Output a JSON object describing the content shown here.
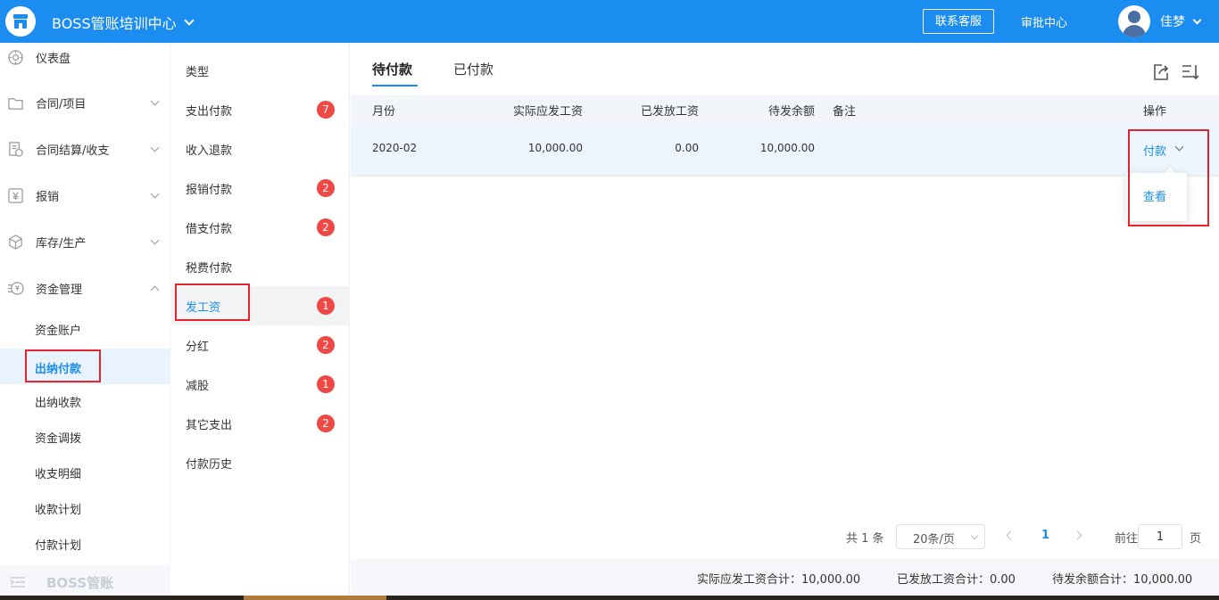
{
  "header": {
    "app_title": "BOSS管账培训中心",
    "service_label": "联系客服",
    "approval_label": "审批中心",
    "username": "佳梦",
    "accent_color": "#1c8df0"
  },
  "sidebar": {
    "items": [
      {
        "label": "仪表盘",
        "icon": "dashboard-icon"
      },
      {
        "label": "合同/项目",
        "icon": "folder-icon"
      },
      {
        "label": "合同结算/收支",
        "icon": "settlement-icon"
      },
      {
        "label": "报销",
        "icon": "yuan-icon"
      },
      {
        "label": "库存/生产",
        "icon": "box-icon"
      },
      {
        "label": "资金管理",
        "icon": "money-icon"
      }
    ],
    "subitems": [
      {
        "label": "资金账户"
      },
      {
        "label": "出纳付款"
      },
      {
        "label": "出纳收款"
      },
      {
        "label": "资金调拨"
      },
      {
        "label": "收支明细"
      },
      {
        "label": "收款计划"
      },
      {
        "label": "付款计划"
      }
    ],
    "footer_label": "BOSS管账"
  },
  "types": {
    "header": "类型",
    "items": [
      {
        "label": "支出付款",
        "badge": "7"
      },
      {
        "label": "收入退款",
        "badge": ""
      },
      {
        "label": "报销付款",
        "badge": "2"
      },
      {
        "label": "借支付款",
        "badge": "2"
      },
      {
        "label": "税费付款",
        "badge": ""
      },
      {
        "label": "发工资",
        "badge": "1"
      },
      {
        "label": "分红",
        "badge": "2"
      },
      {
        "label": "减股",
        "badge": "1"
      },
      {
        "label": "其它支出",
        "badge": "2"
      },
      {
        "label": "付款历史",
        "badge": ""
      }
    ]
  },
  "main": {
    "tabs": [
      {
        "label": "待付款"
      },
      {
        "label": "已付款"
      }
    ],
    "columns": {
      "month": "月份",
      "actual": "实际应发工资",
      "paid": "已发放工资",
      "pending": "待发余额",
      "remark": "备注",
      "op": "操作"
    },
    "rows": [
      {
        "month": "2020-02",
        "actual": "10,000.00",
        "paid": "0.00",
        "pending": "10,000.00",
        "remark": ""
      }
    ],
    "op_label": "付款",
    "dropdown_item": "查看"
  },
  "pagination": {
    "total": "共 1 条",
    "page_size": "20条/页",
    "current_page": "1",
    "goto_label": "前往",
    "goto_value": "1",
    "page_unit": "页"
  },
  "summary": {
    "actual_total": "实际应发工资合计：10,000.00",
    "paid_total": "已发放工资合计：0.00",
    "pending_total": "待发余额合计：10,000.00"
  }
}
